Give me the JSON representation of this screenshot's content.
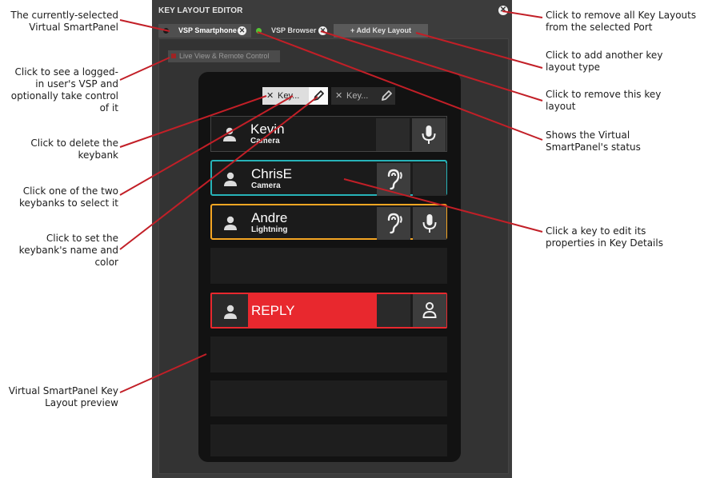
{
  "panel": {
    "title": "KEY LAYOUT EDITOR",
    "tabs": [
      {
        "label": "VSP Smartphone",
        "status_color": "#1a1a1a"
      },
      {
        "label": "VSP Browser",
        "status_color": "#55c535"
      }
    ],
    "add_label": "+ Add Key Layout",
    "live_view_label": "Live View & Remote Control"
  },
  "keybanks": [
    {
      "label": "Key..."
    },
    {
      "label": "Key..."
    }
  ],
  "keys": [
    {
      "name": "Kevin",
      "sub": "Camera",
      "outline": "#555555"
    },
    {
      "name": "ChrisE",
      "sub": "Camera",
      "outline": "#27b3b8"
    },
    {
      "name": "Andre",
      "sub": "Lightning",
      "outline": "#f5a623"
    },
    {
      "name": "REPLY",
      "sub": "",
      "outline": "#e8282e"
    }
  ],
  "colors": {
    "reply_red": "#e8282e",
    "selected_cyan": "#27b3b8",
    "orange": "#f5a623"
  },
  "icons": [
    "close-icon",
    "pencil-icon",
    "user-icon",
    "microphone-icon",
    "ear-icon",
    "listen-user-icon"
  ],
  "callouts": {
    "left": [
      "The currently-selected Virtual SmartPanel",
      "Click to see a logged-in user's VSP and optionally take control of it",
      "Click to delete the keybank",
      "Click one of the two keybanks to select it",
      "Click to set the keybank's name and color",
      "Virtual SmartPanel Key Layout preview"
    ],
    "right": [
      "Click to remove all Key Layouts from the selected Port",
      "Click to add another key layout type",
      "Click to remove this key layout",
      "Shows the Virtual SmartPanel's status",
      "Click a key to edit its properties in Key Details"
    ]
  }
}
